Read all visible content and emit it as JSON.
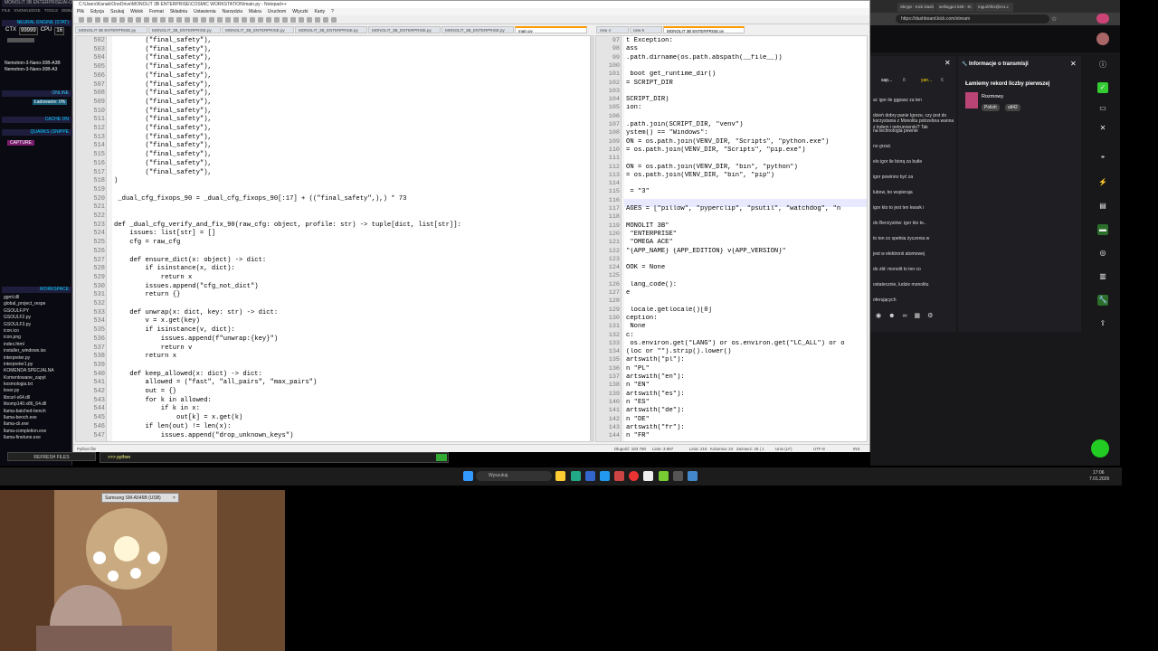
{
  "left_panel": {
    "title": "MONOLIT 3B ENTERPRISE/AI-OMEGA",
    "menu": [
      "FILE",
      "KNOWLEDGE",
      "TOOLS",
      "DEBUG"
    ],
    "header": "NEURAL ENGINE (STAT)",
    "ctx_label": "CTX",
    "ctx_value": "99999",
    "cpu_label": "CPU",
    "cpu_value": "16",
    "models": [
      "Nemotron-3-Nano-30B-A3B",
      "Nemotron-3-Nano-30B-A3"
    ],
    "online": "ONLINE",
    "loading": "Ładowanie: 0%",
    "cache": "CACHE ON",
    "quarks": "QUARKS (SNIPPE",
    "capture": "CAPTURE",
    "workspace": "WORKSPACE",
    "files": [
      "ggml.dll",
      "global_project_respe",
      "GSOULF.PY",
      "GSOULF2.py",
      "GSOULF3.py",
      "icon.ico",
      "icon.png",
      "index.html",
      "installer_windows.iss",
      "interpreter.py",
      "interpreter1.py",
      "KOMENDA SPECJALNA",
      "Komentowane_zapyt",
      "kosmologia.txt",
      "lexer.py",
      "libcurl-x64.dll",
      "libomp140.x86_64.dll",
      "llama-batched-bench",
      "llama-bench.exe",
      "llama-cli.exe",
      "llama-completion.exe",
      "llama-finetune.exe"
    ],
    "refresh": "REFRESH FILES"
  },
  "npp": {
    "title": "C:\\Users\\Kanak\\OneDrive\\MONOLIT 3B ENTERPRISE\\COSMIC WORKSTATION\\main.py - Notepad++",
    "menu": [
      "Plik",
      "Edycja",
      "Szukaj",
      "Widok",
      "Format",
      "Składnia",
      "Ustawienia",
      "Narzędzia",
      "Makra",
      "Uruchom",
      "Wtyczki",
      "Karty",
      "?"
    ],
    "tabs_left": [
      "MONOLIT 3B ENTERPRISE.py",
      "MONOLIT_3B_ENTERPRISE.py",
      "MONOLIT_3B_ENTERPRISE.py",
      "MONOLIT_3B_ENTERPRISE.py",
      "MONOLIT_3B_ENTERPRISE.py",
      "MONOLIT_3B_ENTERPRISE.py",
      "main.py"
    ],
    "tabs_right": [
      "new 4",
      "new 5",
      "MONOLIT 3B ENTERPRISE.py"
    ],
    "left_lines": [
      {
        "n": "502",
        "t": "        (\"final_safety\"),"
      },
      {
        "n": "503",
        "t": "        (\"final_safety\"),"
      },
      {
        "n": "504",
        "t": "        (\"final_safety\"),"
      },
      {
        "n": "505",
        "t": "        (\"final_safety\"),"
      },
      {
        "n": "506",
        "t": "        (\"final_safety\"),"
      },
      {
        "n": "507",
        "t": "        (\"final_safety\"),"
      },
      {
        "n": "508",
        "t": "        (\"final_safety\"),"
      },
      {
        "n": "509",
        "t": "        (\"final_safety\"),"
      },
      {
        "n": "510",
        "t": "        (\"final_safety\"),"
      },
      {
        "n": "511",
        "t": "        (\"final_safety\"),"
      },
      {
        "n": "512",
        "t": "        (\"final_safety\"),"
      },
      {
        "n": "513",
        "t": "        (\"final_safety\"),"
      },
      {
        "n": "514",
        "t": "        (\"final_safety\"),"
      },
      {
        "n": "515",
        "t": "        (\"final_safety\"),"
      },
      {
        "n": "516",
        "t": "        (\"final_safety\"),"
      },
      {
        "n": "517",
        "t": "        (\"final_safety\"),"
      },
      {
        "n": "518",
        "t": ")"
      },
      {
        "n": "519",
        "t": ""
      },
      {
        "n": "520",
        "t": " _dual_cfg_fixops_90 = _dual_cfg_fixops_90[:17] + ((\"final_safety\",),) * 73"
      },
      {
        "n": "521",
        "t": ""
      },
      {
        "n": "522",
        "t": ""
      },
      {
        "n": "523",
        "t": "def _dual_cfg_verify_and_fix_90(raw_cfg: object, profile: str) -> tuple[dict, list[str]]:"
      },
      {
        "n": "524",
        "t": "    issues: list[str] = []"
      },
      {
        "n": "525",
        "t": "    cfg = raw_cfg"
      },
      {
        "n": "526",
        "t": ""
      },
      {
        "n": "527",
        "t": "    def ensure_dict(x: object) -> dict:"
      },
      {
        "n": "528",
        "t": "        if isinstance(x, dict):"
      },
      {
        "n": "529",
        "t": "            return x"
      },
      {
        "n": "530",
        "t": "        issues.append(\"cfg_not_dict\")"
      },
      {
        "n": "531",
        "t": "        return {}"
      },
      {
        "n": "532",
        "t": ""
      },
      {
        "n": "533",
        "t": "    def unwrap(x: dict, key: str) -> dict:"
      },
      {
        "n": "534",
        "t": "        v = x.get(key)"
      },
      {
        "n": "535",
        "t": "        if isinstance(v, dict):"
      },
      {
        "n": "536",
        "t": "            issues.append(f\"unwrap:{key}\")"
      },
      {
        "n": "537",
        "t": "            return v"
      },
      {
        "n": "538",
        "t": "        return x"
      },
      {
        "n": "539",
        "t": ""
      },
      {
        "n": "540",
        "t": "    def keep_allowed(x: dict) -> dict:"
      },
      {
        "n": "541",
        "t": "        allowed = (\"fast\", \"all_pairs\", \"max_pairs\")"
      },
      {
        "n": "542",
        "t": "        out = {}"
      },
      {
        "n": "543",
        "t": "        for k in allowed:"
      },
      {
        "n": "544",
        "t": "            if k in x:"
      },
      {
        "n": "545",
        "t": "                out[k] = x.get(k)"
      },
      {
        "n": "546",
        "t": "        if len(out) != len(x):"
      },
      {
        "n": "547",
        "t": "            issues.append(\"drop_unknown_keys\")"
      }
    ],
    "right_lines": [
      {
        "n": "97",
        "t": "t Exception:"
      },
      {
        "n": "98",
        "t": "ass"
      },
      {
        "n": "99",
        "t": ".path.dirname(os.path.abspath(__file__))"
      },
      {
        "n": "100",
        "t": ""
      },
      {
        "n": "101",
        "t": " boot get_runtime_dir()"
      },
      {
        "n": "102",
        "t": "= SCRIPT_DIR"
      },
      {
        "n": "103",
        "t": ""
      },
      {
        "n": "104",
        "t": "SCRIPT_DIR)"
      },
      {
        "n": "105",
        "t": "ion:"
      },
      {
        "n": "106",
        "t": ""
      },
      {
        "n": "107",
        "t": ".path.join(SCRIPT_DIR, \"venv\")"
      },
      {
        "n": "108",
        "t": "ystem() == \"Windows\":"
      },
      {
        "n": "109",
        "t": "ON = os.path.join(VENV_DIR, \"Scripts\", \"python.exe\")"
      },
      {
        "n": "110",
        "t": "= os.path.join(VENV_DIR, \"Scripts\", \"pip.exe\")"
      },
      {
        "n": "111",
        "t": ""
      },
      {
        "n": "112",
        "t": "ON = os.path.join(VENV_DIR, \"bin\", \"python\")"
      },
      {
        "n": "113",
        "t": "= os.path.join(VENV_DIR, \"bin\", \"pip\")"
      },
      {
        "n": "114",
        "t": ""
      },
      {
        "n": "115",
        "t": " = \"3\""
      },
      {
        "n": "116",
        "t": ""
      },
      {
        "n": "117",
        "t": "AGES = [\"pillow\", \"pyperclip\", \"psutil\", \"watchdog\", \"n"
      },
      {
        "n": "118",
        "t": ""
      },
      {
        "n": "119",
        "t": "MONOLIT 3B\""
      },
      {
        "n": "120",
        "t": " \"ENTERPRISE\""
      },
      {
        "n": "121",
        "t": " \"OMEGA ACE\""
      },
      {
        "n": "122",
        "t": "\"{APP_NAME} {APP_EDITION} v{APP_VERSION}\""
      },
      {
        "n": "123",
        "t": ""
      },
      {
        "n": "124",
        "t": "OOK = None"
      },
      {
        "n": "125",
        "t": ""
      },
      {
        "n": "126",
        "t": " lang_code():"
      },
      {
        "n": "127",
        "t": "e"
      },
      {
        "n": "128",
        "t": ""
      },
      {
        "n": "129",
        "t": " locale.getlocale()[0]"
      },
      {
        "n": "130",
        "t": "ception:"
      },
      {
        "n": "131",
        "t": " None"
      },
      {
        "n": "132",
        "t": "c:"
      },
      {
        "n": "133",
        "t": " os.environ.get(\"LANG\") or os.environ.get(\"LC_ALL\") or o"
      },
      {
        "n": "134",
        "t": "(loc or \"\").strip().lower()"
      },
      {
        "n": "135",
        "t": "artswith(\"pl\"):"
      },
      {
        "n": "136",
        "t": "n \"PL\""
      },
      {
        "n": "137",
        "t": "artswith(\"en\"):"
      },
      {
        "n": "138",
        "t": "n \"EN\""
      },
      {
        "n": "139",
        "t": "artswith(\"es\"):"
      },
      {
        "n": "140",
        "t": "n \"ES\""
      },
      {
        "n": "141",
        "t": "artswith(\"de\"):"
      },
      {
        "n": "142",
        "t": "n \"DE\""
      },
      {
        "n": "143",
        "t": "artswith(\"fr\"):"
      },
      {
        "n": "144",
        "t": "n \"FR\""
      }
    ],
    "status_left": "Python file",
    "status_right": [
      "Długość: 183 790",
      "Linie: 3 897",
      "Linia: 215",
      "Kolumna: 24",
      "Zaznacz: 25 | 1",
      "Unix (LF)",
      "UTF-8",
      "INS"
    ]
  },
  "python_bar": ">>> python",
  "browser": {
    "tabs": [
      "Skrypt - Kick Dash",
      "sellingpoi 528 - Ki",
      "mgurl/this@m1.c"
    ],
    "url": "https://dashboard.kick.com/stream",
    "chat_users": [
      "sap...",
      "yan..."
    ],
    "chat_counts": [
      "8",
      "6"
    ],
    "chat_messages": [
      "ai: igor ile ggpasz za ten",
      "dzień dobry panie Igorze, czy jest do korzystania z Monolitu potrzebna wanna z lodem i netrunnerski? Tak",
      "na technologia pewnie",
      "no grzać.",
      "elo igor ile biorą za butle",
      "igor powinno być za",
      "lubow, bo wspieraja",
      "igor kto to jest ten kwark i",
      "do Berciystów: igor kto te..",
      "to ten co spełnia życzenia w",
      "jest w elektronii atomowej",
      "do zbł: monolit to ten co",
      "ostatecznie, ludzie monolitu",
      "oferujących"
    ],
    "info_title": "Informacje o transmisji",
    "stream_title": "Łamiemy rekord liczby pierwszej",
    "category": "Rozmowy",
    "tags": [
      "Polish",
      "alt42"
    ]
  },
  "taskbar": {
    "search_placeholder": "Wyszukaj",
    "time": "17:06",
    "date": "7.01.2026"
  },
  "webcam": {
    "label": "Samsung SM-A546B (USB)"
  }
}
